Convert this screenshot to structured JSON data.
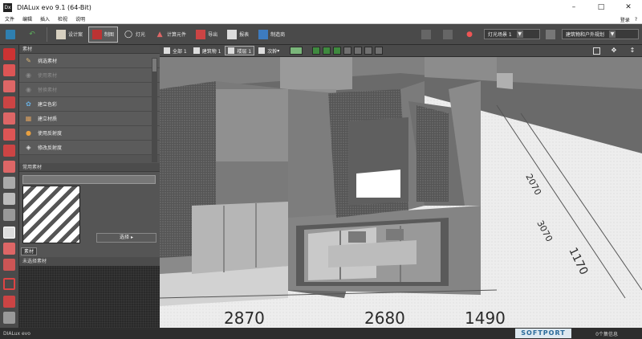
{
  "window": {
    "title": "DIALux evo 9.1  (64-Bit)",
    "logo_text": "Dx"
  },
  "menu": {
    "items": [
      "文件",
      "编辑",
      "插入",
      "检视",
      "说明"
    ],
    "login": "登录",
    "help": "?"
  },
  "toolbar": {
    "buttons": [
      "设计案",
      "制图",
      "灯光",
      "计算元件",
      "导出",
      "报表",
      "制造商"
    ],
    "scene_select": "灯光场景 1",
    "view_select": "建筑物和户外规划"
  },
  "viewbar": {
    "items": [
      "全部 1",
      "建筑物 1",
      "楼层 1",
      "次幹"
    ]
  },
  "left_panel": {
    "header": "素材",
    "items": [
      {
        "label": "挑选素材",
        "enabled": true
      },
      {
        "label": "使用素材",
        "enabled": false
      },
      {
        "label": "替换素材",
        "enabled": false
      },
      {
        "label": "建立色彩",
        "enabled": true
      },
      {
        "label": "建立材质",
        "enabled": true
      },
      {
        "label": "使用反射度",
        "enabled": true
      },
      {
        "label": "修改反射度",
        "enabled": true
      }
    ],
    "used_header": "常用素材",
    "select_button": "选择",
    "material_tag": "素材",
    "material_none": "未选择素材"
  },
  "viewport": {
    "dim_labels": [
      "2870",
      "2680",
      "1490",
      "2070",
      "3070",
      "1170"
    ]
  },
  "statusbar": {
    "left": "DIALux evo",
    "right": "0个集信息",
    "watermark": "SOFTPORT"
  }
}
